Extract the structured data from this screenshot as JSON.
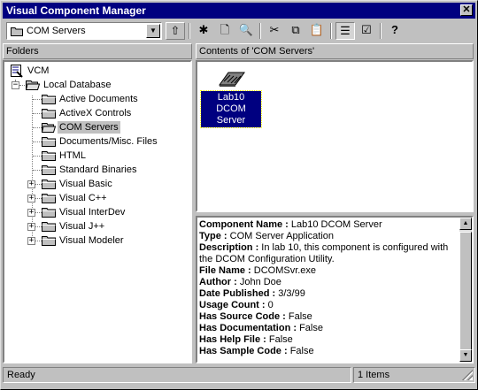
{
  "window": {
    "title": "Visual Component Manager",
    "close_glyph": "✕"
  },
  "toolbar": {
    "combo_value": "COM Servers",
    "buttons": [
      {
        "name": "up-one-level",
        "glyph": "⇧"
      },
      {
        "name": "new-component",
        "glyph": "✱"
      },
      {
        "name": "new",
        "glyph": "🗋"
      },
      {
        "name": "find",
        "glyph": "🔍"
      },
      {
        "name": "cut",
        "glyph": "✂"
      },
      {
        "name": "copy",
        "glyph": "⧉"
      },
      {
        "name": "paste",
        "glyph": "📋"
      },
      {
        "name": "tree-view",
        "glyph": "☰"
      },
      {
        "name": "properties",
        "glyph": "☑"
      },
      {
        "name": "help",
        "glyph": "?"
      }
    ]
  },
  "folders_header": "Folders",
  "contents_header": "Contents of 'COM Servers'",
  "tree": {
    "root": "VCM",
    "database": "Local Database",
    "items": [
      "Active Documents",
      "ActiveX Controls",
      "COM Servers",
      "Documents/Misc. Files",
      "HTML",
      "Standard Binaries",
      "Visual Basic",
      "Visual C++",
      "Visual InterDev",
      "Visual J++",
      "Visual Modeler"
    ],
    "selected": "COM Servers",
    "expanders": [
      "−",
      "−",
      "+",
      "+",
      "+",
      "+",
      "+"
    ]
  },
  "content_item": {
    "line1": "Lab10 DCOM",
    "line2": "Server"
  },
  "details": [
    {
      "key": "Component Name :",
      "value": "Lab10 DCOM Server"
    },
    {
      "key": "Type :",
      "value": "COM Server Application"
    },
    {
      "key": "Description :",
      "value": "In lab 10, this component is configured with"
    },
    {
      "key": "",
      "value": "the DCOM Configuration Utility."
    },
    {
      "key": "File Name :",
      "value": "DCOMSvr.exe"
    },
    {
      "key": "Author :",
      "value": "John Doe"
    },
    {
      "key": "Date Published :",
      "value": "3/3/99"
    },
    {
      "key": "Usage Count :",
      "value": "0"
    },
    {
      "key": "Has Source Code :",
      "value": "False"
    },
    {
      "key": "Has Documentation :",
      "value": "False"
    },
    {
      "key": "Has Help File :",
      "value": "False"
    },
    {
      "key": "Has Sample Code :",
      "value": "False"
    }
  ],
  "scroll": {
    "up": "▲",
    "down": "▼"
  },
  "status": {
    "left": "Ready",
    "right": "1 Items"
  },
  "colors": {
    "selection": "#000080",
    "titlebar": "#000080",
    "face": "#c0c0c0"
  }
}
